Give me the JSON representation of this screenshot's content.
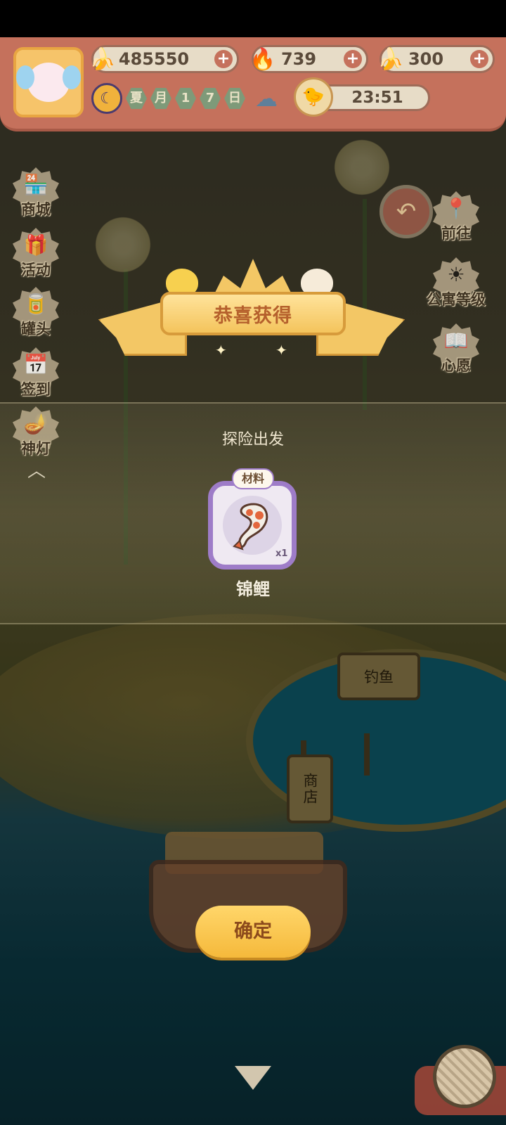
{
  "resources": [
    {
      "icon": "banana-icon",
      "value": "485550"
    },
    {
      "icon": "blue-flame-icon",
      "value": "739"
    },
    {
      "icon": "blue-banana-icon",
      "value": "300"
    }
  ],
  "calendar": {
    "cells": [
      "夏",
      "月",
      "1",
      "7",
      "日"
    ]
  },
  "timer": "23:51",
  "sidebar": {
    "left": [
      {
        "label": "商城",
        "icon": "shop-icon"
      },
      {
        "label": "活动",
        "icon": "gift-icon"
      },
      {
        "label": "罐头",
        "icon": "can-icon"
      },
      {
        "label": "签到",
        "icon": "calendar-icon"
      },
      {
        "label": "神灯",
        "icon": "magic-lamp-icon"
      }
    ],
    "right": [
      {
        "label": "前往",
        "icon": "map-pin-icon"
      },
      {
        "label": "公寓等级",
        "icon": "sun-icon"
      },
      {
        "label": "心愿",
        "icon": "heart-book-icon"
      }
    ]
  },
  "scene": {
    "sign_fishing": "钓鱼",
    "sign_shop": "商店"
  },
  "dialog": {
    "title": "恭喜获得",
    "section": "探险出发",
    "item": {
      "tag": "材料",
      "name": "锦鲤",
      "qty": "x1",
      "icon": "koi-fish-icon"
    },
    "confirm": "确定"
  },
  "colors": {
    "topbar": "#c5715c",
    "confirm": "#f5b93b",
    "item_border": "#9e7cc8"
  }
}
